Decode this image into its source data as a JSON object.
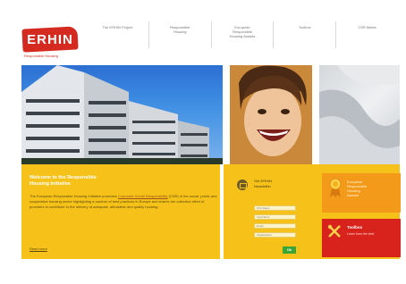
{
  "header": {
    "logo_text": "ERHIN",
    "logo_tagline": "Responsible Housing",
    "nav": [
      "The ERHIN Project",
      "Responsible\nHousing",
      "European\nResponsible\nHousing Awards",
      "Toolbox",
      "CSR Matrix"
    ]
  },
  "welcome": {
    "title": "Welcome to the Responsible\nHousing Initiative",
    "body_pre": "The European Responsible Housing Initiative promotes ",
    "body_link": "Corporate Social Responsibility",
    "body_post": " (CSR) in the social, public and cooperative housing sector highlighting a number of best practices in Europe and shares the collective effort of providers to contribute to the delivery of adequate, affordable and quality housing.",
    "read_more": "Read more"
  },
  "newsletter": {
    "label": "Get ERHIN\nNewsletter",
    "fields": [
      "First Name",
      "Last Name",
      "Email",
      "Organisation"
    ],
    "submit": "Ok"
  },
  "cards": {
    "awards": "European\nResponsible\nHousing\nAwards",
    "toolbox_title": "Toolbox",
    "toolbox_sub": "Learn from the best"
  },
  "colors": {
    "yellow": "#f6c21a",
    "orange": "#f39a1a",
    "red": "#d8231d",
    "green": "#3aa535"
  }
}
